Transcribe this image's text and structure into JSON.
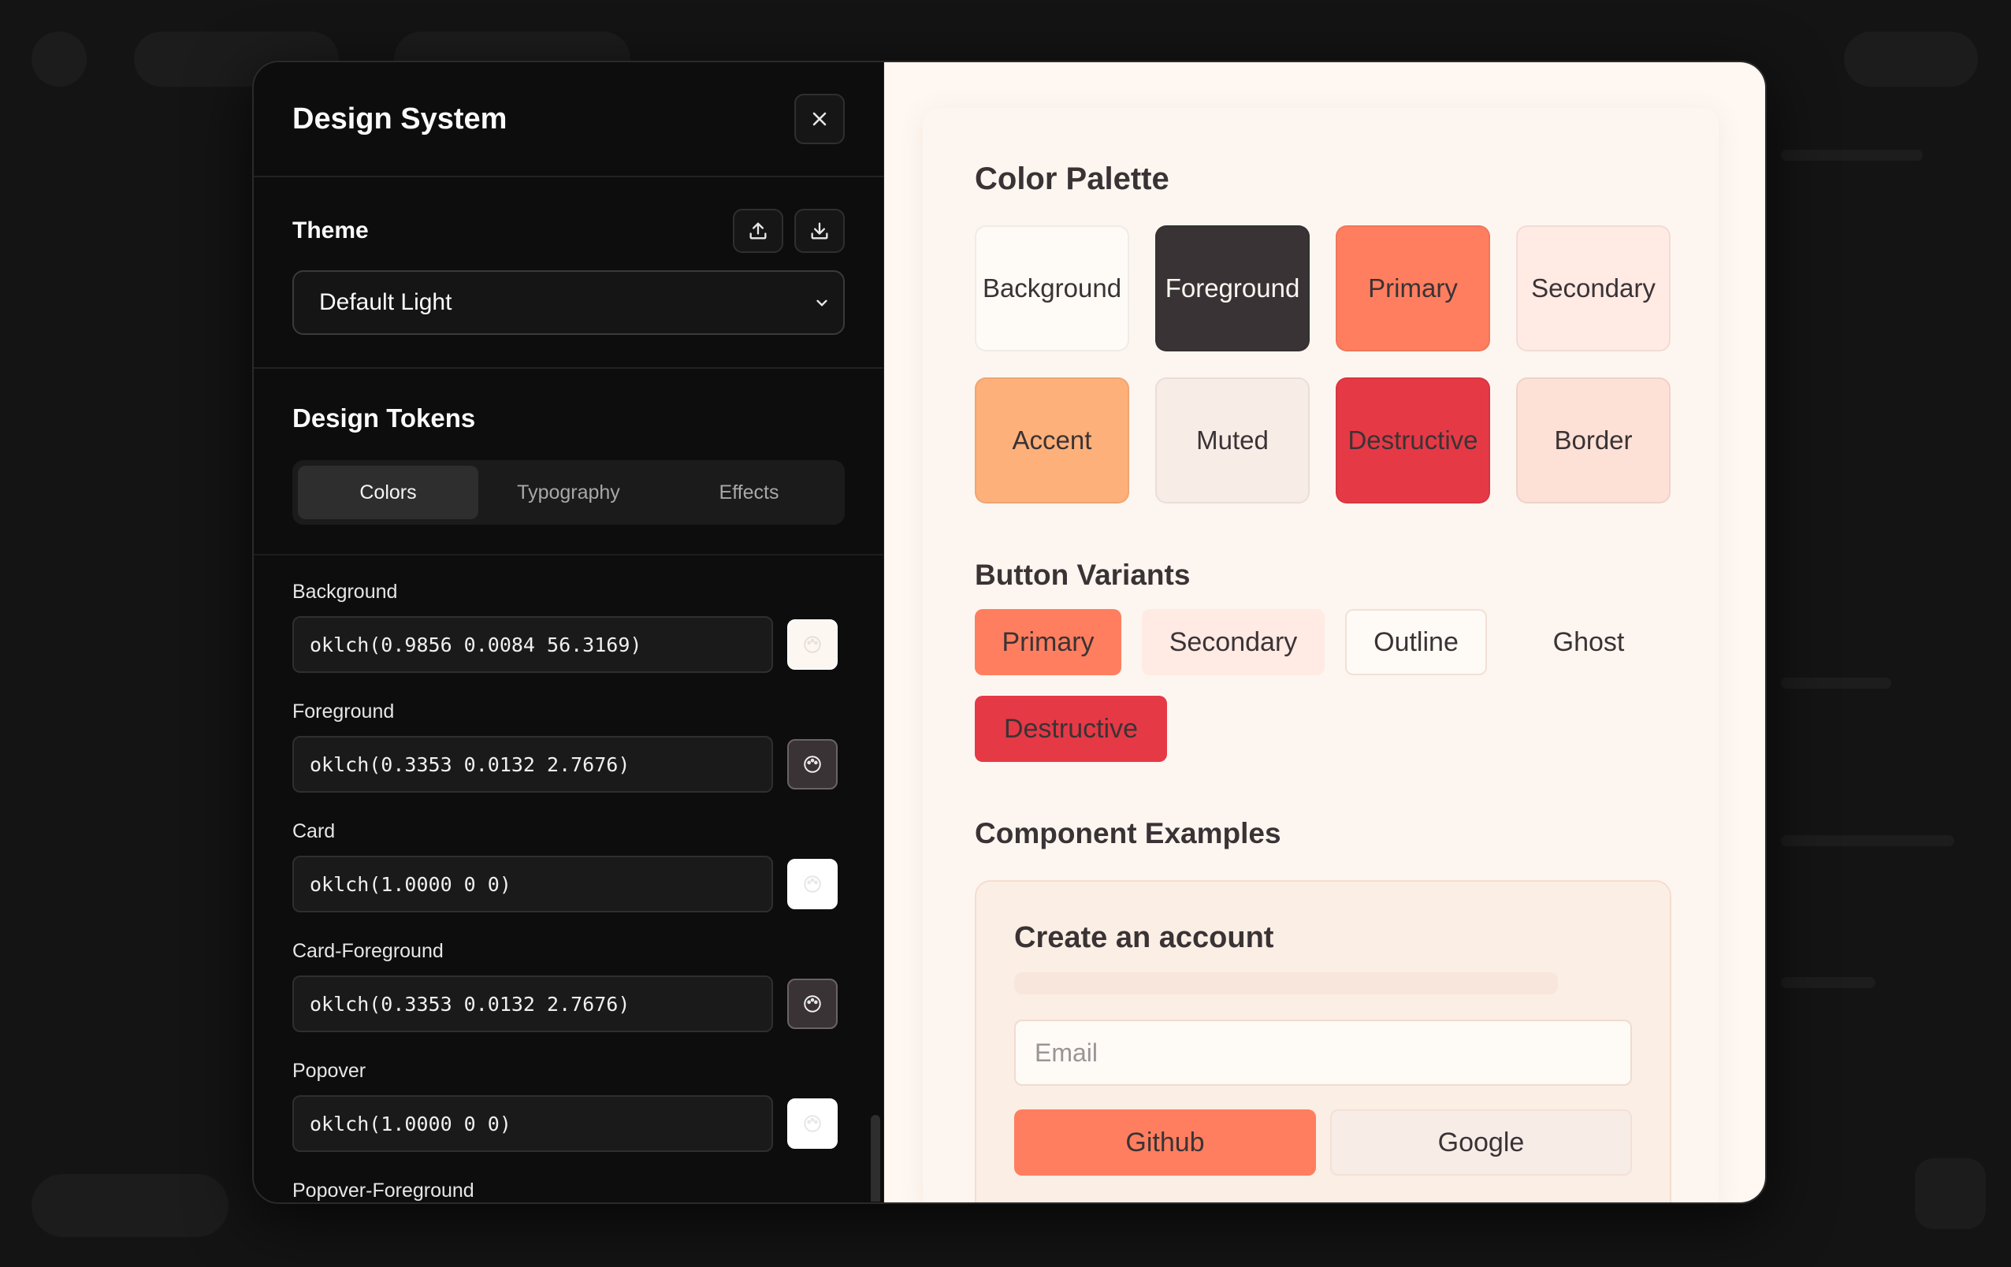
{
  "modal": {
    "title": "Design System",
    "close_icon": "close-icon"
  },
  "theme": {
    "label": "Theme",
    "selected": "Default Light",
    "upload_icon": "upload-icon",
    "download_icon": "download-icon"
  },
  "tokens": {
    "title": "Design Tokens",
    "tabs": [
      "Colors",
      "Typography",
      "Effects"
    ],
    "active_tab": "Colors",
    "items": [
      {
        "label": "Background",
        "value": "oklch(0.9856 0.0084 56.3169)",
        "color": "#fdf7f2"
      },
      {
        "label": "Foreground",
        "value": "oklch(0.3353 0.0132 2.7676)",
        "color": "#3a3335"
      },
      {
        "label": "Card",
        "value": "oklch(1.0000 0 0)",
        "color": "#ffffff"
      },
      {
        "label": "Card-Foreground",
        "value": "oklch(0.3353 0.0132 2.7676)",
        "color": "#3a3335"
      },
      {
        "label": "Popover",
        "value": "oklch(1.0000 0 0)",
        "color": "#ffffff"
      },
      {
        "label": "Popover-Foreground",
        "value": "",
        "color": "#3a3335"
      }
    ]
  },
  "preview": {
    "palette_title": "Color Palette",
    "palette": [
      {
        "name": "Background",
        "bg": "#fefaf6",
        "fg": "#3a3335"
      },
      {
        "name": "Foreground",
        "bg": "#3a3335",
        "fg": "#fdf6f0"
      },
      {
        "name": "Primary",
        "bg": "#ff7e5f",
        "fg": "#3a3335"
      },
      {
        "name": "Secondary",
        "bg": "#ffeae4",
        "fg": "#3a3335"
      },
      {
        "name": "Accent",
        "bg": "#feb07a",
        "fg": "#3a3335"
      },
      {
        "name": "Muted",
        "bg": "#f8ece6",
        "fg": "#3a3335"
      },
      {
        "name": "Destructive",
        "bg": "#e63946",
        "fg": "#3a3335"
      },
      {
        "name": "Border",
        "bg": "#fde0d6",
        "fg": "#3a3335"
      }
    ],
    "buttons_title": "Button Variants",
    "buttons": [
      {
        "name": "Primary",
        "variant": "primary"
      },
      {
        "name": "Secondary",
        "variant": "secondary"
      },
      {
        "name": "Outline",
        "variant": "outline"
      },
      {
        "name": "Ghost",
        "variant": "ghost"
      },
      {
        "name": "Destructive",
        "variant": "destructive"
      }
    ],
    "components_title": "Component Examples",
    "form": {
      "title": "Create an account",
      "email_placeholder": "Email",
      "github_label": "Github",
      "google_label": "Google"
    }
  }
}
